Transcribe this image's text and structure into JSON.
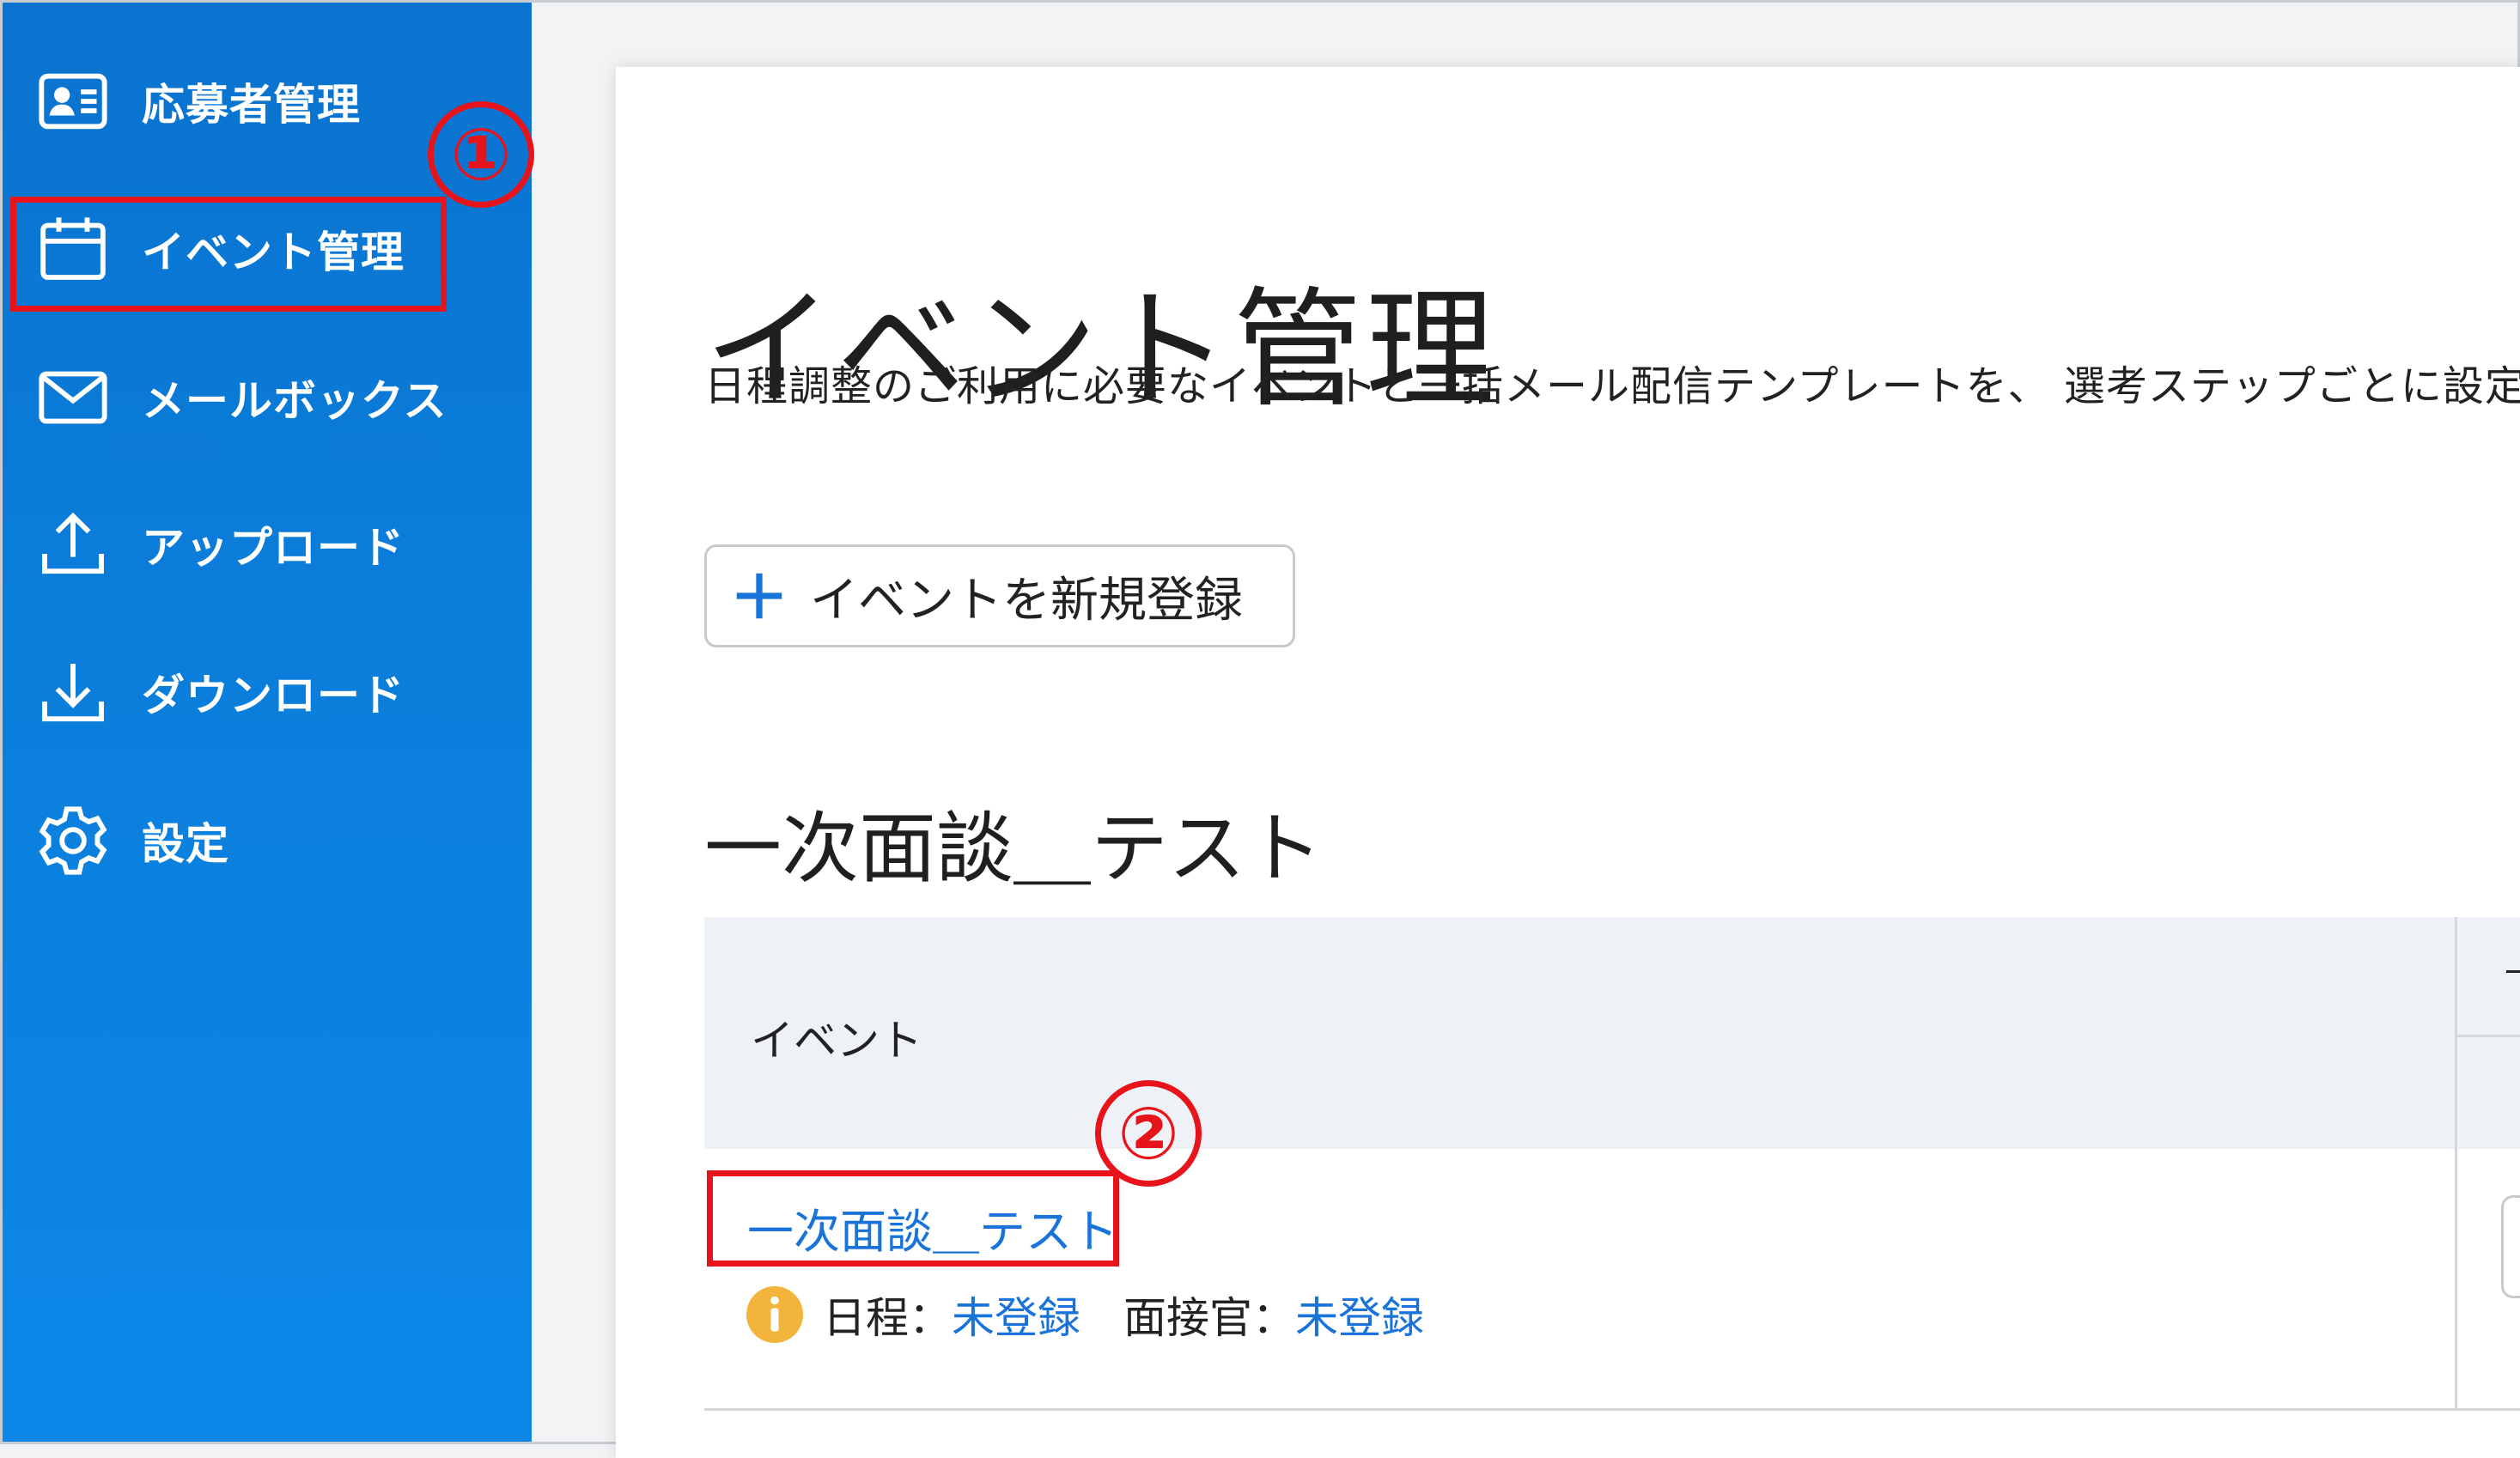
{
  "sidebar": {
    "items": [
      {
        "label": "応募者管理",
        "icon": "applicant-card-icon"
      },
      {
        "label": "イベント管理",
        "icon": "calendar-icon"
      },
      {
        "label": "メールボックス",
        "icon": "mail-icon"
      },
      {
        "label": "アップロード",
        "icon": "upload-icon"
      },
      {
        "label": "ダウンロード",
        "icon": "download-icon"
      },
      {
        "label": "設定",
        "icon": "gear-icon"
      }
    ]
  },
  "annotations": {
    "step1": "①",
    "step2": "②",
    "color": "#e8141c"
  },
  "main": {
    "title": "イベント管理",
    "description": "日程調整のご利用に必要なイベントと一括メール配信テンプレートを、 選考ステップごとに設定",
    "add_button_label": "イベントを新規登録",
    "section": {
      "title": "一次面談＿テスト",
      "table_header_event": "イベント",
      "table_header_right": "一",
      "rows": [
        {
          "event_name": "一次面談＿テスト",
          "schedule_label": "日程：",
          "schedule_value": "未登録",
          "interviewer_label": "面接官：",
          "interviewer_value": "未登録"
        }
      ]
    }
  },
  "colors": {
    "sidebar_top": "#0a73cf",
    "sidebar_bottom": "#0c87e8",
    "link": "#1a73d9",
    "info_icon": "#f2b43a"
  }
}
